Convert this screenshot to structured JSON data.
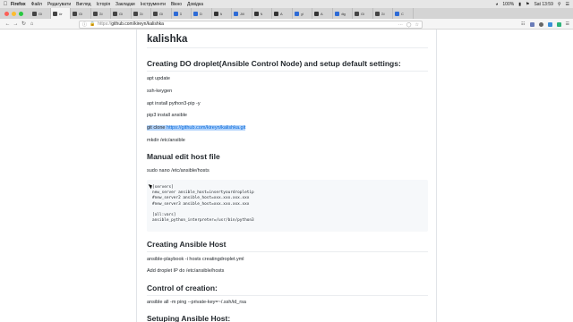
{
  "menubar": {
    "app_name": "Firefox",
    "items": [
      "Файл",
      "Редагувати",
      "Вигляд",
      "Історія",
      "Закладки",
      "Інструменти",
      "Вікно",
      "Довідка"
    ],
    "battery": "100%",
    "clock": "Sat 13:59"
  },
  "tabs": [
    {
      "label": "Gi",
      "color": "#444444"
    },
    {
      "label": "kir",
      "color": "#444444",
      "active": true
    },
    {
      "label": "Gi",
      "color": "#444444"
    },
    {
      "label": "Gi",
      "color": "#444444"
    },
    {
      "label": "Gi",
      "color": "#444444"
    },
    {
      "label": "Gi",
      "color": "#444444"
    },
    {
      "label": "Gi",
      "color": "#444444"
    },
    {
      "label": "D",
      "color": "#2e6bd6"
    },
    {
      "label": "D",
      "color": "#2e6bd6"
    },
    {
      "label": "A",
      "color": "#333333"
    },
    {
      "label": "Jill",
      "color": "#2e6bd6"
    },
    {
      "label": "N",
      "color": "#333333"
    },
    {
      "label": "A",
      "color": "#333333"
    },
    {
      "label": "gl",
      "color": "#2e6bd6"
    },
    {
      "label": "A",
      "color": "#333333"
    },
    {
      "label": "dig",
      "color": "#2e6bd6"
    },
    {
      "label": "Gi",
      "color": "#444444"
    },
    {
      "label": "Gi",
      "color": "#444444"
    },
    {
      "label": "C",
      "color": "#2e6bd6"
    }
  ],
  "toolbar": {
    "url_protocol": "https://",
    "url_host": "github.com/kireyn/kalishka"
  },
  "readme": {
    "title": "kalishka",
    "section1": {
      "heading": "Creating DO droplet(Ansible Control Node) and setup default settings:",
      "lines": [
        "apt update",
        "ssh-keygen",
        "apt install python3-pip -y",
        "pip3 install ansible"
      ],
      "git_clone_prefix": "git clone ",
      "git_clone_link": "https://github.com/kireyn/kalishka.git",
      "mkdir": "mkdir /etc/ansible"
    },
    "section2": {
      "heading": "Manual edit host file",
      "command": "sudo nano /etc/ansible/hosts",
      "code_lines": [
        "[servers]",
        "new_server ansible_host=insertyourdropletip",
        "#new_server2 ansible_host=xxx.xxx.xxx.xxx",
        "#new_server3 ansible_host=xxx.xxx.xxx.xxx",
        "",
        "[all:vars]",
        "ansible_python_interpreter=/usr/bin/python3"
      ]
    },
    "section3": {
      "heading": "Creating Ansible Host",
      "lines": [
        "ansible-playbook -i hosts creatingdroplet.yml",
        "Add droplet IP do /etc/ansible/hosts"
      ]
    },
    "section4": {
      "heading": "Control of creation:",
      "lines": [
        "ansible all -m ping --private-key=~/.ssh/id_rsa"
      ]
    },
    "section5": {
      "heading": "Setuping Ansible Host:"
    }
  }
}
